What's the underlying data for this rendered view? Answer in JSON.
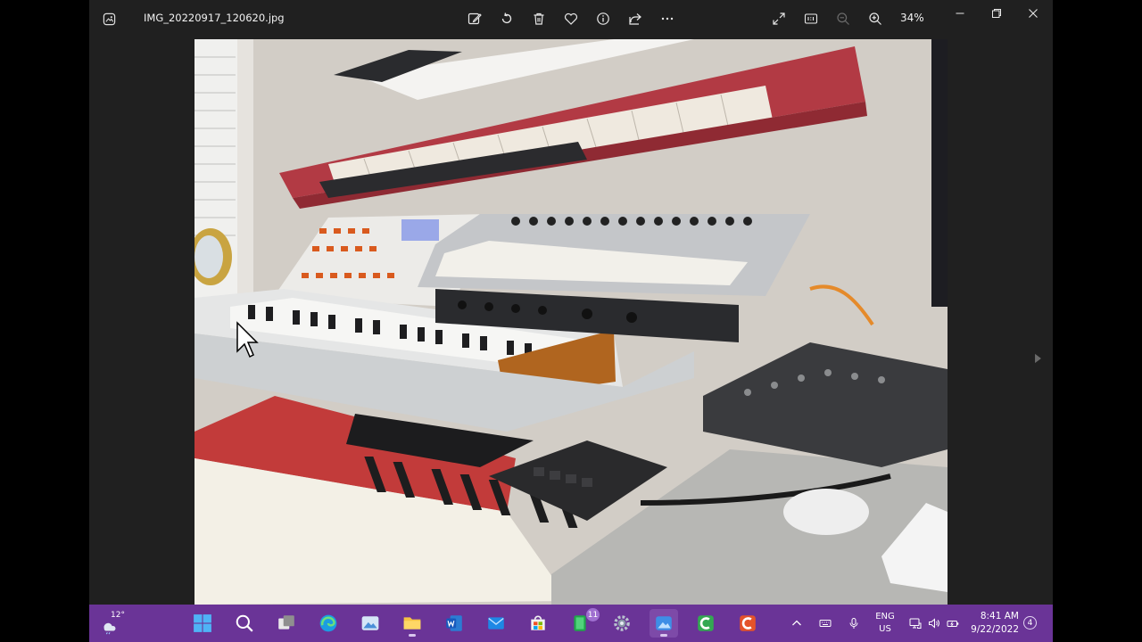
{
  "titlebar": {
    "file_name": "IMG_20220917_120620.jpg",
    "zoom_level": "34%",
    "toolbar_icons": [
      "edit-image-icon",
      "rotate-icon",
      "delete-icon",
      "favorite-icon",
      "info-icon",
      "share-icon",
      "more-icon",
      "fullscreen-icon",
      "actual-size-icon",
      "zoom-out-icon",
      "zoom-in-icon"
    ],
    "window_controls": [
      "minimize-icon",
      "maximize-icon",
      "close-icon"
    ]
  },
  "colors": {
    "window_bg": "#202020",
    "taskbar_bg": "#6a3497",
    "badge_bg": "#9f6fd0"
  },
  "taskbar": {
    "weather_temp": "12°",
    "mail_badge": "11",
    "apps": [
      "start-icon",
      "search-icon",
      "task-view-icon",
      "edge-icon",
      "photos-app-icon",
      "file-explorer-icon",
      "word-icon",
      "mail-icon",
      "store-icon",
      "excel-like-icon",
      "settings-icon",
      "photos-active-icon",
      "camtasia-green-icon",
      "camtasia-red-icon"
    ],
    "language": {
      "line1": "ENG",
      "line2": "US"
    },
    "clock": {
      "time": "8:41 AM",
      "date": "9/22/2022"
    },
    "notification_count": "4"
  }
}
